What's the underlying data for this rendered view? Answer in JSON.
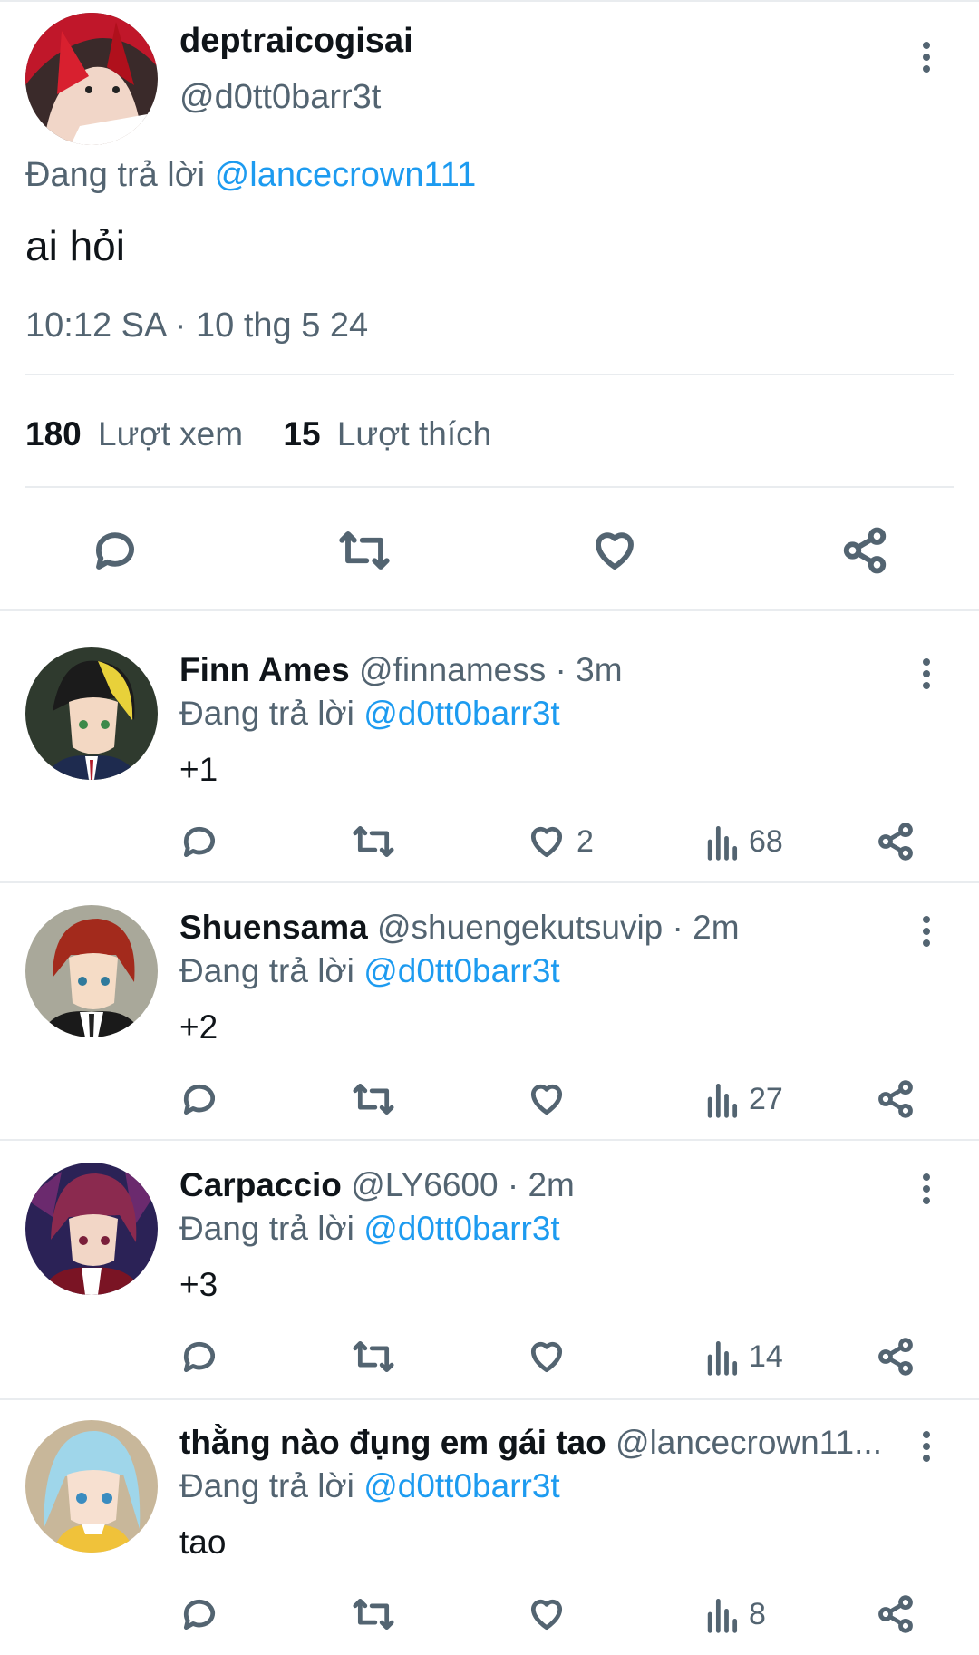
{
  "main_tweet": {
    "display_name": "deptraicogisai",
    "handle": "@d0tt0barr3t",
    "replying_prefix": "Đang trả lời",
    "replying_to": "@lancecrown111",
    "text": "ai hỏi",
    "timestamp": "10:12 SA · 10 thg 5 24",
    "views_count": "180",
    "views_label": "Lượt xem",
    "likes_count": "15",
    "likes_label": "Lượt thích"
  },
  "replies": [
    {
      "display_name": "Finn Ames",
      "meta": "@finnamess · 3m",
      "replying_prefix": "Đang trả lời",
      "replying_to": "@d0tt0barr3t",
      "text": "+1",
      "likes": "2",
      "views": "68"
    },
    {
      "display_name": "Shuensama",
      "meta": "@shuengekutsuvip · 2m",
      "replying_prefix": "Đang trả lời",
      "replying_to": "@d0tt0barr3t",
      "text": "+2",
      "likes": "",
      "views": "27"
    },
    {
      "display_name": "Carpaccio",
      "meta": "@LY6600 · 2m",
      "replying_prefix": "Đang trả lời",
      "replying_to": "@d0tt0barr3t",
      "text": "+3",
      "likes": "",
      "views": "14"
    },
    {
      "display_name": "thằng nào đụng em gái tao",
      "meta": "@lancecrown11...",
      "replying_prefix": "Đang trả lời",
      "replying_to": "@d0tt0barr3t",
      "text": "tao",
      "likes": "",
      "views": "8"
    }
  ],
  "colors": {
    "link": "#1d9bf0",
    "secondary_text": "#536471",
    "divider": "#e9ecef"
  },
  "icons": [
    "reply-icon",
    "retweet-icon",
    "like-icon",
    "share-icon",
    "views-icon",
    "more-icon"
  ]
}
